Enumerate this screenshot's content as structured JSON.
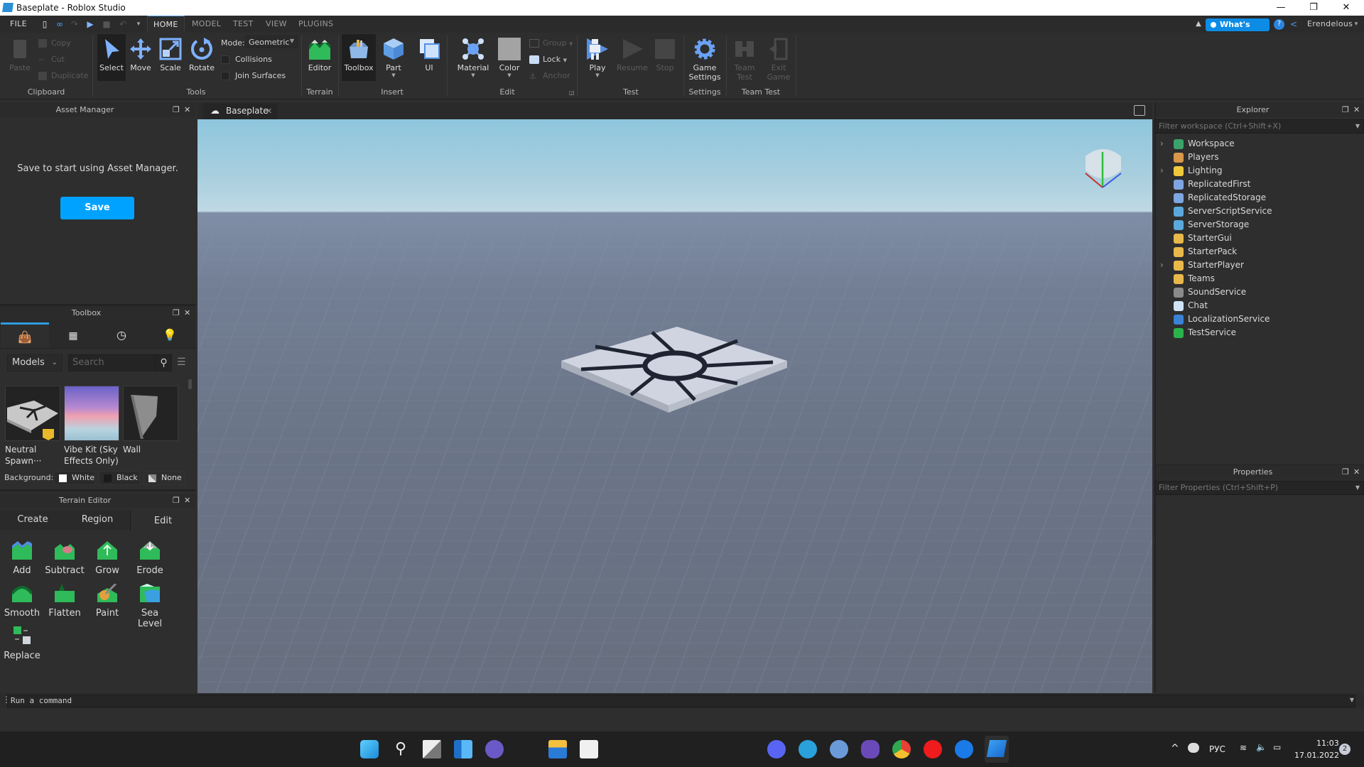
{
  "window": {
    "title": "Baseplate - Roblox Studio",
    "controls": {
      "minimize": "—",
      "maximize": "❐",
      "close": "✕"
    }
  },
  "menu": {
    "file": "FILE",
    "tabs": [
      "HOME",
      "MODEL",
      "TEST",
      "VIEW",
      "PLUGINS"
    ],
    "active_tab": "HOME",
    "whats_new": "What's New",
    "user": "Erendelous"
  },
  "ribbon": {
    "clipboard": {
      "paste": "Paste",
      "copy": "Copy",
      "cut": "Cut",
      "duplicate": "Duplicate",
      "group": "Clipboard"
    },
    "tools": {
      "select": "Select",
      "move": "Move",
      "scale": "Scale",
      "rotate": "Rotate",
      "mode_label": "Mode:",
      "mode_value": "Geometric",
      "collisions": "Collisions",
      "join_surfaces": "Join Surfaces",
      "group": "Tools"
    },
    "terrain": {
      "editor": "Editor",
      "group": "Terrain"
    },
    "insert": {
      "toolbox": "Toolbox",
      "part": "Part",
      "ui": "UI",
      "group": "Insert"
    },
    "edit": {
      "material": "Material",
      "color": "Color",
      "group_btn": "Group",
      "lock": "Lock",
      "anchor": "Anchor",
      "group": "Edit"
    },
    "test": {
      "play": "Play",
      "resume": "Resume",
      "stop": "Stop",
      "group": "Test"
    },
    "settings": {
      "game_settings_1": "Game",
      "game_settings_2": "Settings",
      "group": "Settings"
    },
    "team_test": {
      "team_test_1": "Team",
      "team_test_2": "Test",
      "exit_game_1": "Exit",
      "exit_game_2": "Game",
      "group": "Team Test"
    }
  },
  "asset_manager": {
    "title": "Asset Manager",
    "message": "Save to start using Asset Manager.",
    "save": "Save"
  },
  "toolbox": {
    "title": "Toolbox",
    "tabs": [
      "marketplace",
      "inventory",
      "recent",
      "creations"
    ],
    "category": "Models",
    "search_placeholder": "Search",
    "assets": [
      {
        "name_1": "Neutral",
        "name_2": "Spawn···"
      },
      {
        "name_1": "Vibe Kit (Sky",
        "name_2": "Effects Only)"
      },
      {
        "name_1": "Wall",
        "name_2": ""
      }
    ],
    "background_label": "Background:",
    "background_options": [
      "White",
      "Black",
      "None"
    ]
  },
  "terrain_editor": {
    "title": "Terrain Editor",
    "tabs": [
      "Create",
      "Region",
      "Edit"
    ],
    "active_tab": "Edit",
    "tools": [
      "Add",
      "Subtract",
      "Grow",
      "Erode",
      "Smooth",
      "Flatten",
      "Paint",
      "Sea Level",
      "Replace"
    ]
  },
  "document": {
    "tab": "Baseplate"
  },
  "explorer": {
    "title": "Explorer",
    "filter_placeholder": "Filter workspace (Ctrl+Shift+X)",
    "items": [
      {
        "label": "Workspace",
        "expandable": true,
        "color": "#3aa36b"
      },
      {
        "label": "Players",
        "expandable": false,
        "color": "#d8984a"
      },
      {
        "label": "Lighting",
        "expandable": true,
        "color": "#f0c83c"
      },
      {
        "label": "ReplicatedFirst",
        "expandable": false,
        "color": "#7ea6e0"
      },
      {
        "label": "ReplicatedStorage",
        "expandable": false,
        "color": "#7ea6e0"
      },
      {
        "label": "ServerScriptService",
        "expandable": false,
        "color": "#5aa8dc"
      },
      {
        "label": "ServerStorage",
        "expandable": false,
        "color": "#5aa8dc"
      },
      {
        "label": "StarterGui",
        "expandable": false,
        "color": "#e8b84a"
      },
      {
        "label": "StarterPack",
        "expandable": false,
        "color": "#e8b84a"
      },
      {
        "label": "StarterPlayer",
        "expandable": true,
        "color": "#e8b84a"
      },
      {
        "label": "Teams",
        "expandable": false,
        "color": "#e8b84a"
      },
      {
        "label": "SoundService",
        "expandable": false,
        "color": "#8a8a8a"
      },
      {
        "label": "Chat",
        "expandable": false,
        "color": "#cfe3f7"
      },
      {
        "label": "LocalizationService",
        "expandable": false,
        "color": "#3b82d6"
      },
      {
        "label": "TestService",
        "expandable": false,
        "color": "#2bb24c"
      }
    ]
  },
  "properties": {
    "title": "Properties",
    "filter_placeholder": "Filter Properties (Ctrl+Shift+P)"
  },
  "command_bar": {
    "placeholder": "Run a command"
  },
  "taskbar": {
    "apps": [
      "start",
      "search",
      "task-view",
      "widgets",
      "teams-chat",
      "file-explorer",
      "microsoft-store",
      "discord",
      "telegram",
      "qbittorrent",
      "obsidian",
      "chrome",
      "youtube-music",
      "roblox-player",
      "roblox-studio"
    ],
    "language": "РУС",
    "time": "11:03",
    "date": "17.01.2022",
    "notifications": "2"
  },
  "colors": {
    "accent": "#00a2ff",
    "whats_new": "#0d8ce6",
    "tab_accent": "#4d9be3"
  }
}
